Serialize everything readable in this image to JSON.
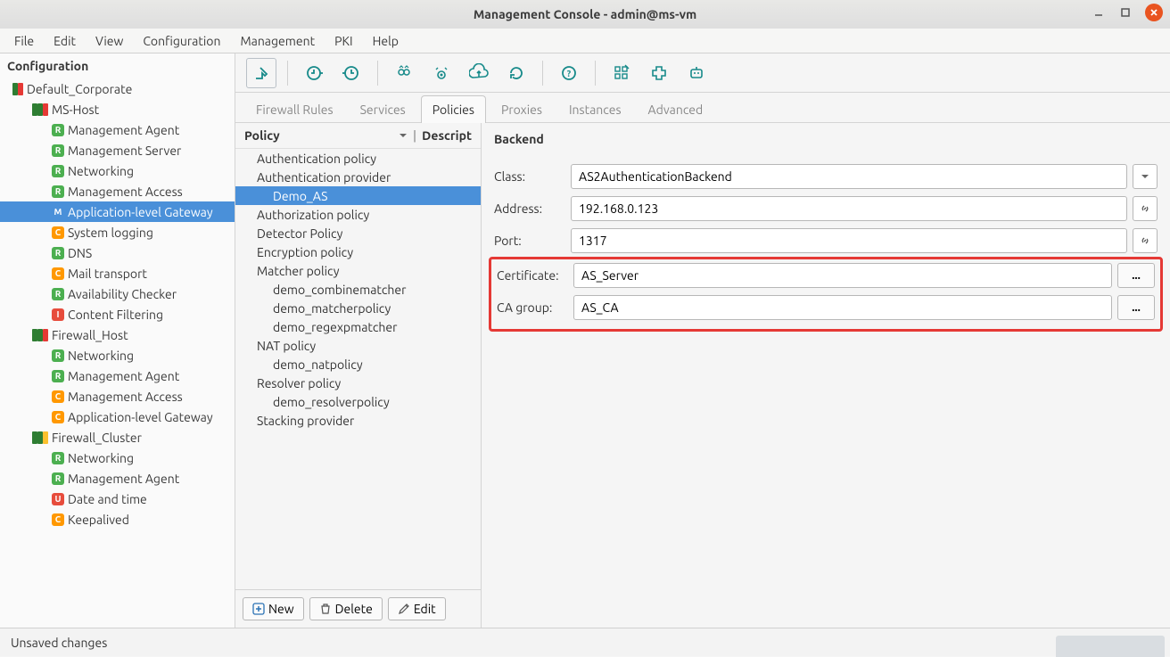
{
  "window": {
    "title": "Management Console - admin@ms-vm"
  },
  "menu": [
    "File",
    "Edit",
    "View",
    "Configuration",
    "Management",
    "PKI",
    "Help"
  ],
  "sidebar": {
    "header": "Configuration",
    "tree": [
      {
        "depth": 0,
        "stripes": [
          "g",
          "r"
        ],
        "label": "Default_Corporate",
        "sel": false
      },
      {
        "depth": 1,
        "stripes": [
          "g",
          "g",
          "r"
        ],
        "label": "MS-Host"
      },
      {
        "depth": 2,
        "badge": "R",
        "label": "Management Agent"
      },
      {
        "depth": 2,
        "badge": "R",
        "label": "Management Server"
      },
      {
        "depth": 2,
        "badge": "R",
        "label": "Networking"
      },
      {
        "depth": 2,
        "badge": "R",
        "label": "Management Access"
      },
      {
        "depth": 2,
        "badge": "M",
        "label": "Application-level Gateway",
        "sel": true
      },
      {
        "depth": 2,
        "badge": "C",
        "label": "System logging"
      },
      {
        "depth": 2,
        "badge": "R",
        "label": "DNS"
      },
      {
        "depth": 2,
        "badge": "C",
        "label": "Mail transport"
      },
      {
        "depth": 2,
        "badge": "R",
        "label": "Availability Checker"
      },
      {
        "depth": 2,
        "badge": "I",
        "label": "Content Filtering"
      },
      {
        "depth": 1,
        "stripes": [
          "g",
          "g",
          "r"
        ],
        "label": "Firewall_Host"
      },
      {
        "depth": 2,
        "badge": "R",
        "label": "Networking"
      },
      {
        "depth": 2,
        "badge": "R",
        "label": "Management Agent"
      },
      {
        "depth": 2,
        "badge": "C",
        "label": "Management Access"
      },
      {
        "depth": 2,
        "badge": "C",
        "label": "Application-level Gateway"
      },
      {
        "depth": 1,
        "stripes": [
          "g",
          "g",
          "y"
        ],
        "label": "Firewall_Cluster"
      },
      {
        "depth": 2,
        "badge": "R",
        "label": "Networking"
      },
      {
        "depth": 2,
        "badge": "R",
        "label": "Management Agent"
      },
      {
        "depth": 2,
        "badge": "U",
        "label": "Date and time"
      },
      {
        "depth": 2,
        "badge": "C",
        "label": "Keepalived"
      }
    ]
  },
  "tabs": {
    "items": [
      "Firewall Rules",
      "Services",
      "Policies",
      "Proxies",
      "Instances",
      "Advanced"
    ],
    "active": 2
  },
  "policies": {
    "header": {
      "col1": "Policy",
      "col2": "Descript"
    },
    "tree": [
      {
        "lvl": 1,
        "label": "Authentication policy"
      },
      {
        "lvl": 1,
        "label": "Authentication provider"
      },
      {
        "lvl": 2,
        "label": "Demo_AS",
        "sel": true
      },
      {
        "lvl": 1,
        "label": "Authorization policy"
      },
      {
        "lvl": 1,
        "label": "Detector Policy"
      },
      {
        "lvl": 1,
        "label": "Encryption policy"
      },
      {
        "lvl": 1,
        "label": "Matcher policy"
      },
      {
        "lvl": 2,
        "label": "demo_combinematcher"
      },
      {
        "lvl": 2,
        "label": "demo_matcherpolicy"
      },
      {
        "lvl": 2,
        "label": "demo_regexpmatcher"
      },
      {
        "lvl": 1,
        "label": "NAT policy"
      },
      {
        "lvl": 2,
        "label": "demo_natpolicy"
      },
      {
        "lvl": 1,
        "label": "Resolver policy"
      },
      {
        "lvl": 2,
        "label": "demo_resolverpolicy"
      },
      {
        "lvl": 1,
        "label": "Stacking provider"
      }
    ],
    "actions": {
      "new": "New",
      "delete": "Delete",
      "edit": "Edit"
    }
  },
  "form": {
    "title": "Backend",
    "class_label": "Class:",
    "class_value": "AS2AuthenticationBackend",
    "address_label": "Address:",
    "address_value": "192.168.0.123",
    "port_label": "Port:",
    "port_value": "1317",
    "cert_label": "Certificate:",
    "cert_value": "AS_Server",
    "ca_label": "CA group:",
    "ca_value": "AS_CA",
    "dots": "..."
  },
  "statusbar": {
    "text": "Unsaved changes"
  }
}
